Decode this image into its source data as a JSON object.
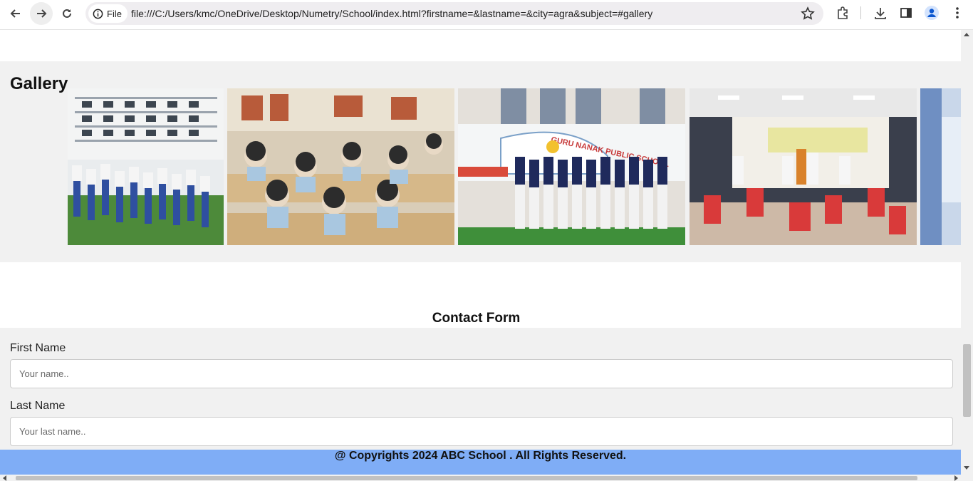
{
  "browser": {
    "file_chip_label": "File",
    "url": "file:///C:/Users/kmc/OneDrive/Desktop/Numetry/School/index.html?firstname=&lastname=&city=agra&subject=#gallery",
    "icons": [
      "back-icon",
      "forward-icon",
      "reload-icon",
      "info-icon",
      "star-icon",
      "extensions-icon",
      "download-icon",
      "side-panel-icon",
      "profile-icon",
      "menu-icon"
    ]
  },
  "gallery": {
    "title": "Gallery",
    "photos": [
      {
        "name": "gallery-photo-assembly"
      },
      {
        "name": "gallery-photo-classroom"
      },
      {
        "name": "gallery-photo-choir"
      },
      {
        "name": "gallery-photo-dance"
      },
      {
        "name": "gallery-photo-partial"
      }
    ],
    "banner_text": "GURU NANAK PUBLIC SCHOOL"
  },
  "contact": {
    "title": "Contact Form",
    "first_name_label": "First Name",
    "first_name_placeholder": "Your name..",
    "last_name_label": "Last Name",
    "last_name_placeholder": "Your last name.."
  },
  "footer": {
    "text": "@ Copyrights 2024 ABC School . All Rights Reserved."
  },
  "colors": {
    "footer_bg": "#7fadf6",
    "section_bg": "#f1f1f1"
  }
}
